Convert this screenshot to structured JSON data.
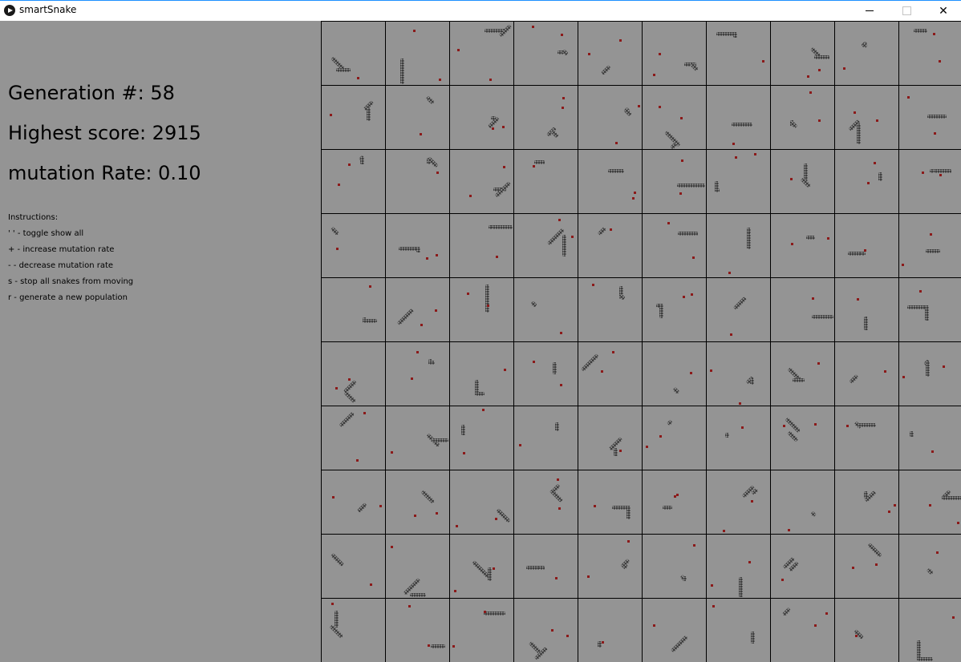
{
  "window": {
    "title": "smartSnake",
    "minimize_glyph": "—",
    "maximize_glyph": "☐",
    "close_glyph": "✕"
  },
  "stats": {
    "generation": "Generation #: 58",
    "highest_score": "Highest score: 2915",
    "mutation_rate": "mutation Rate: 0.10"
  },
  "instructions": {
    "heading": "Instructions:",
    "items": [
      "' ' - toggle show all",
      "+ - increase mutation rate",
      "- - decrease mutation rate",
      "s - stop all snakes from moving",
      "r - generate a new population"
    ]
  },
  "colors": {
    "background": "#949494",
    "grid_line": "#000000",
    "snake": "#3a3a3a",
    "food": "#8b1a1a"
  },
  "icons": {
    "app": "play-icon",
    "minimize": "minimize-icon",
    "maximize": "maximize-icon",
    "close": "close-icon"
  },
  "game": {
    "columns": 10,
    "rows": 10
  }
}
